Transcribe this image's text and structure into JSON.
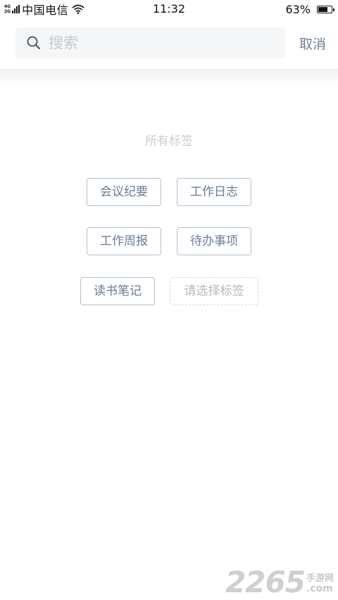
{
  "status_bar": {
    "network_top": "4G",
    "network_bottom": "2G",
    "carrier": "中国电信",
    "time": "11:32",
    "battery_percent": "63%",
    "battery_level": 0.63
  },
  "search": {
    "placeholder": "搜索",
    "value": "",
    "cancel_label": "取消",
    "icon": "search-icon"
  },
  "tags_section": {
    "title": "所有标签",
    "tags": [
      "会议纪要",
      "工作日志",
      "工作周报",
      "待办事项",
      "读书笔记"
    ],
    "add_tag_placeholder": "请选择标签"
  },
  "watermark": {
    "number": "2265",
    "site": "手游网",
    "suffix": ".com"
  },
  "colors": {
    "accent_text": "#6b7b98",
    "tag_border": "#b5bfd3",
    "search_bg": "#f5f6f8",
    "muted_text": "#c9ccd3"
  }
}
